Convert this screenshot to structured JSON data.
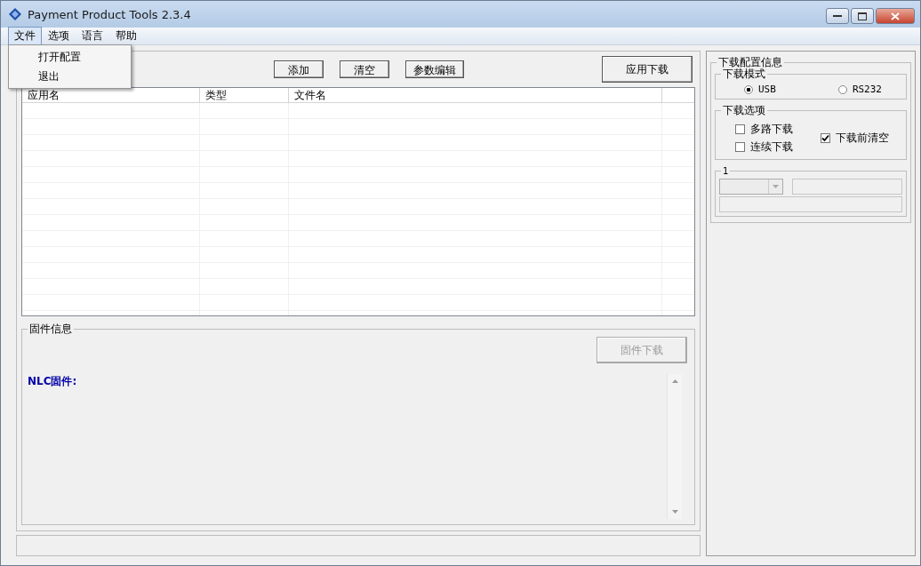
{
  "window": {
    "title": "Payment Product Tools 2.3.4"
  },
  "menu": [
    {
      "label": "文件",
      "selected": true
    },
    {
      "label": "选项",
      "selected": false
    },
    {
      "label": "语言",
      "selected": false
    },
    {
      "label": "帮助",
      "selected": false
    }
  ],
  "dropdown": {
    "items": [
      "打开配置",
      "退出"
    ]
  },
  "toolbar": {
    "buttons": [
      "添加",
      "清空",
      "参数编辑"
    ],
    "primary": "应用下载"
  },
  "table": {
    "columns": [
      "应用名",
      "类型",
      "文件名"
    ]
  },
  "firmware": {
    "title": "固件信息",
    "button": {
      "label": "固件下载",
      "disabled": true
    },
    "label": "NLC固件:"
  },
  "config": {
    "title": "下载配置信息",
    "mode": {
      "title": "下载模式",
      "options": [
        {
          "label": "USB",
          "selected": true
        },
        {
          "label": "RS232",
          "selected": false
        }
      ]
    },
    "options": {
      "title": "下载选项",
      "items": [
        {
          "label": "多路下载",
          "checked": false
        },
        {
          "label": "连续下载",
          "checked": false
        },
        {
          "label": "下载前清空",
          "checked": true
        }
      ]
    },
    "port": {
      "title": "1"
    }
  }
}
